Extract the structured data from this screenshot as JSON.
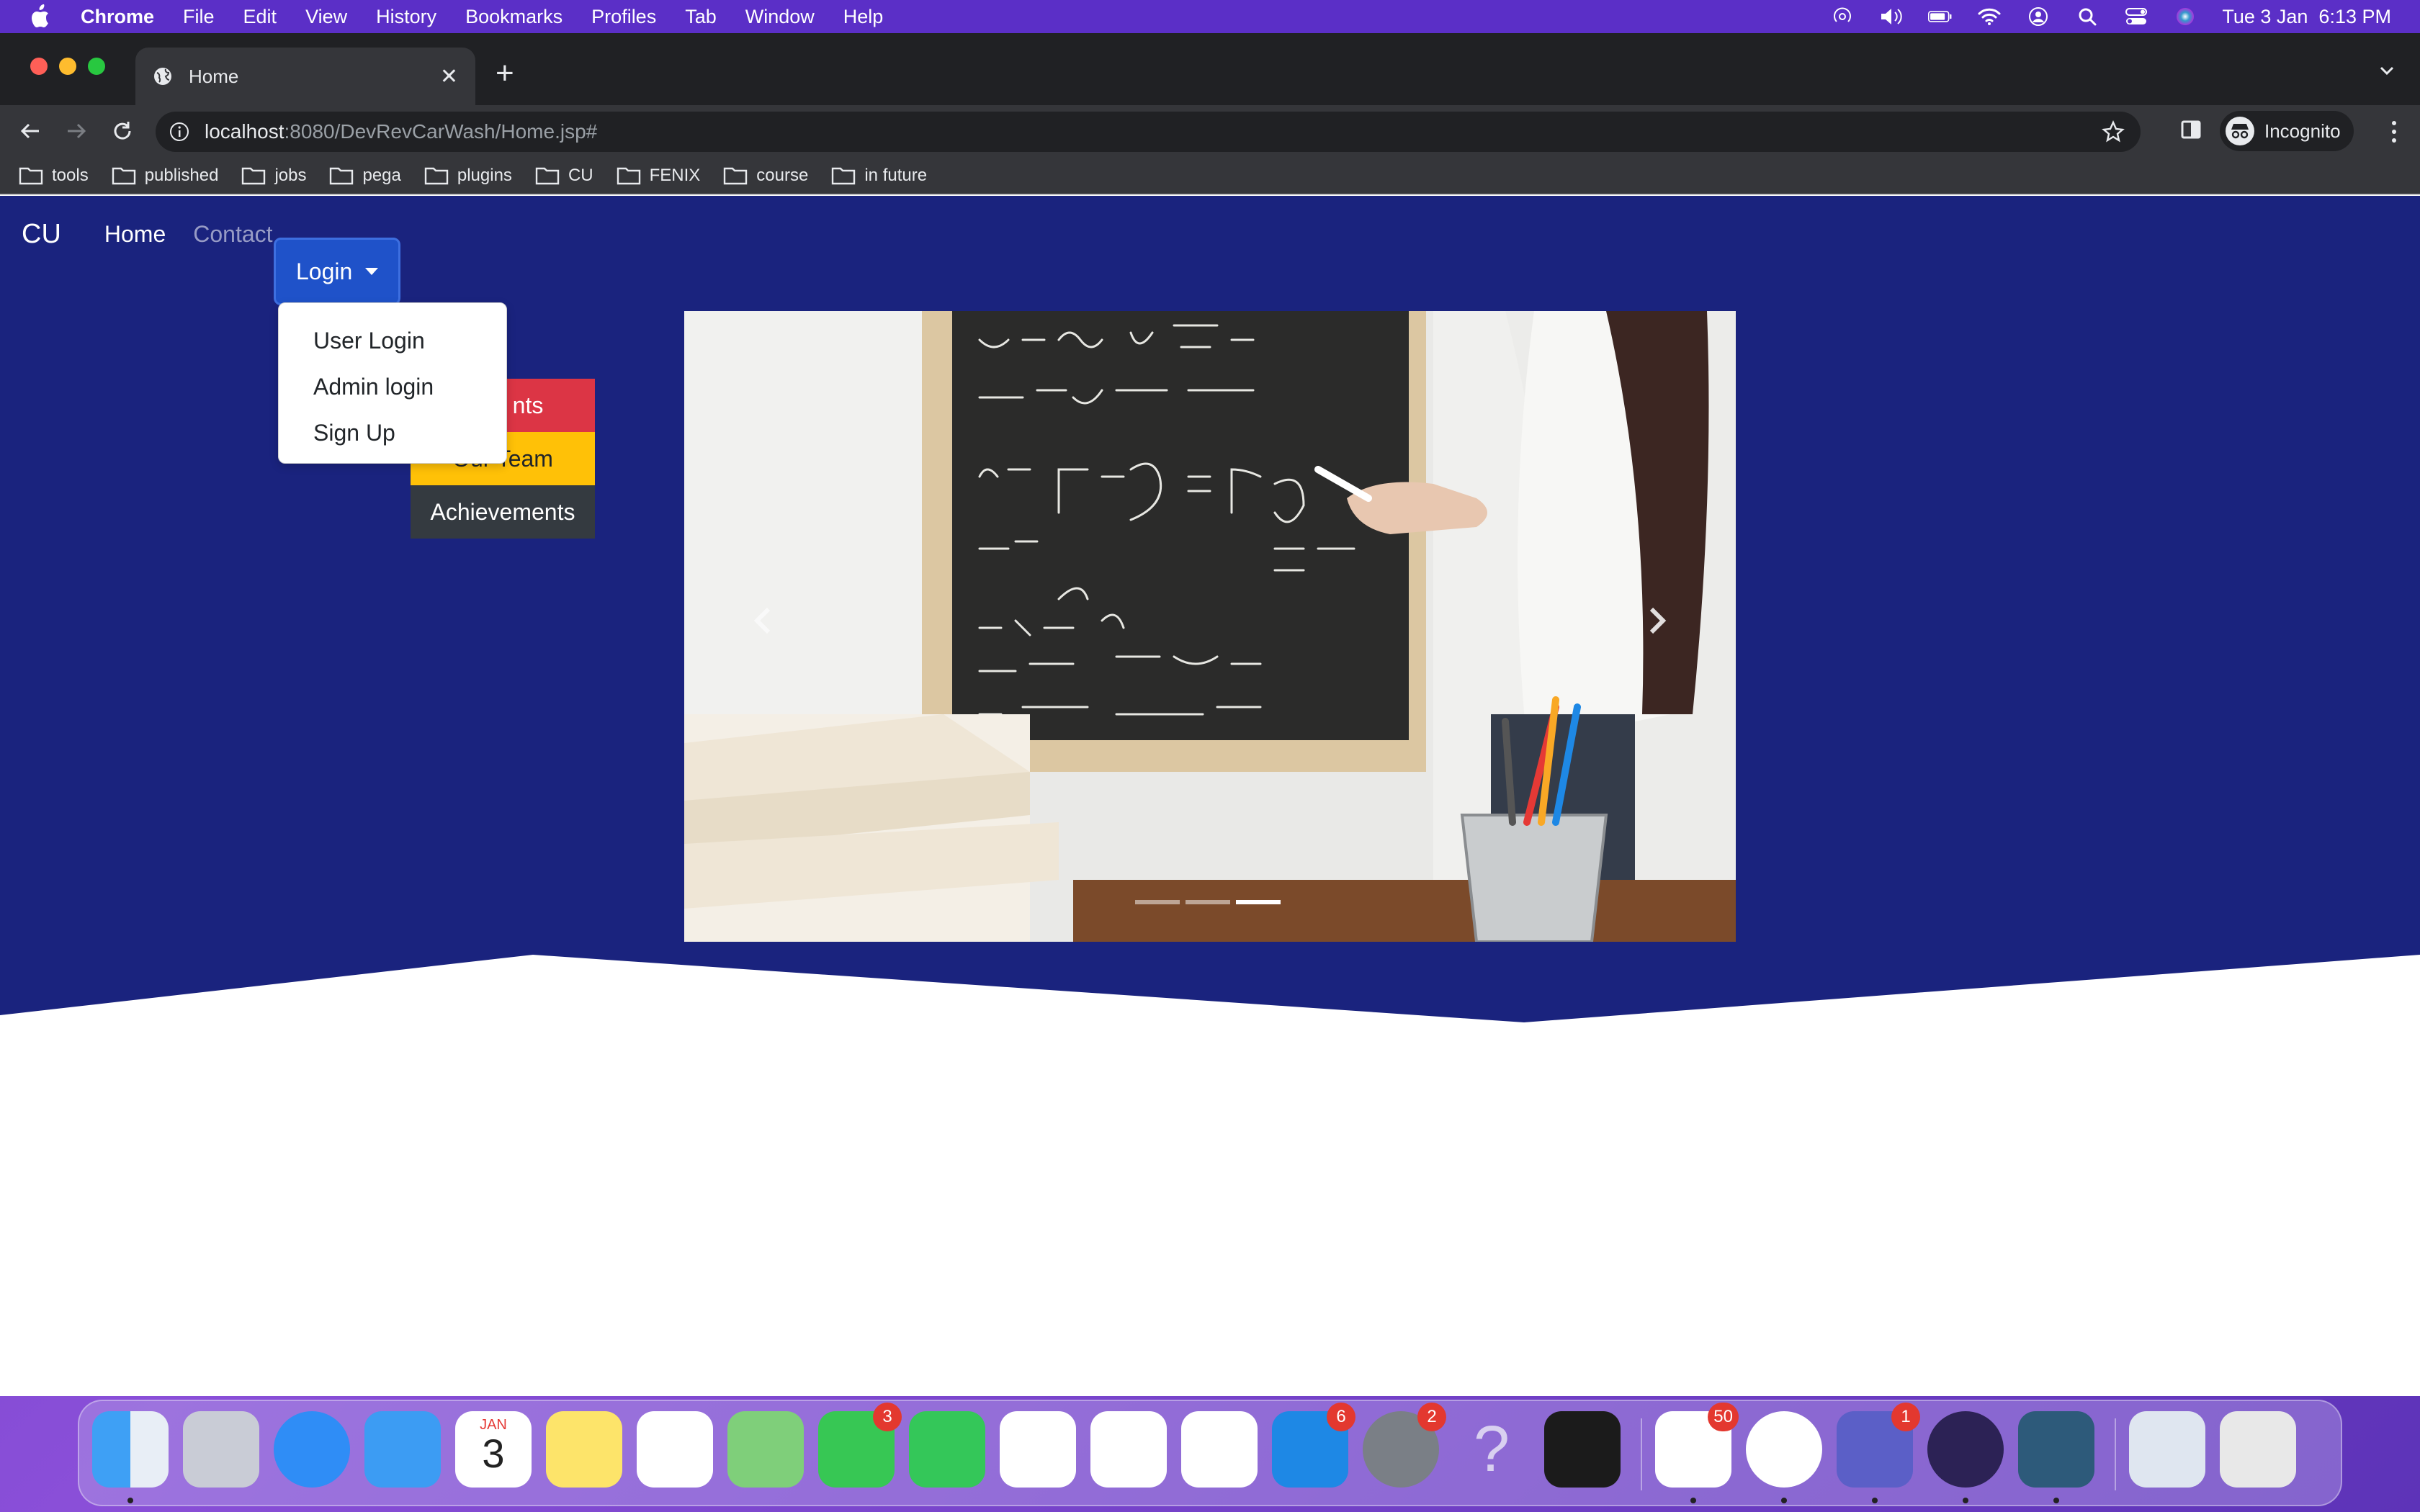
{
  "menubar": {
    "app": "Chrome",
    "items": [
      "File",
      "Edit",
      "View",
      "History",
      "Bookmarks",
      "Profiles",
      "Tab",
      "Window",
      "Help"
    ],
    "datetime": "Tue 3 Jan  6:13 PM"
  },
  "browser": {
    "tab_title": "Home",
    "url_host": "localhost",
    "url_path": ":8080/DevRevCarWash/Home.jsp#",
    "profile_label": "Incognito",
    "bookmarks": [
      "tools",
      "published",
      "jobs",
      "pega",
      "plugins",
      "CU",
      "FENIX",
      "course",
      "in future"
    ]
  },
  "page": {
    "brand": "CU",
    "nav": {
      "home": "Home",
      "contact": "Contact",
      "login": "Login"
    },
    "login_menu": [
      "User Login",
      "Admin login",
      "Sign Up"
    ],
    "side_buttons": {
      "first": "nts",
      "second": "Our Team",
      "third": "Achievements"
    },
    "carousel": {
      "slide_count": 3,
      "active_index": 2
    },
    "colors": {
      "hero_bg": "#1a237e",
      "login_bg": "#1f52c9"
    }
  },
  "dock": {
    "calendar_month": "JAN",
    "calendar_day": "3",
    "badges": {
      "messages": "3",
      "app_store": "6",
      "system_prefs": "2",
      "slack": "50",
      "teams": "1"
    }
  }
}
